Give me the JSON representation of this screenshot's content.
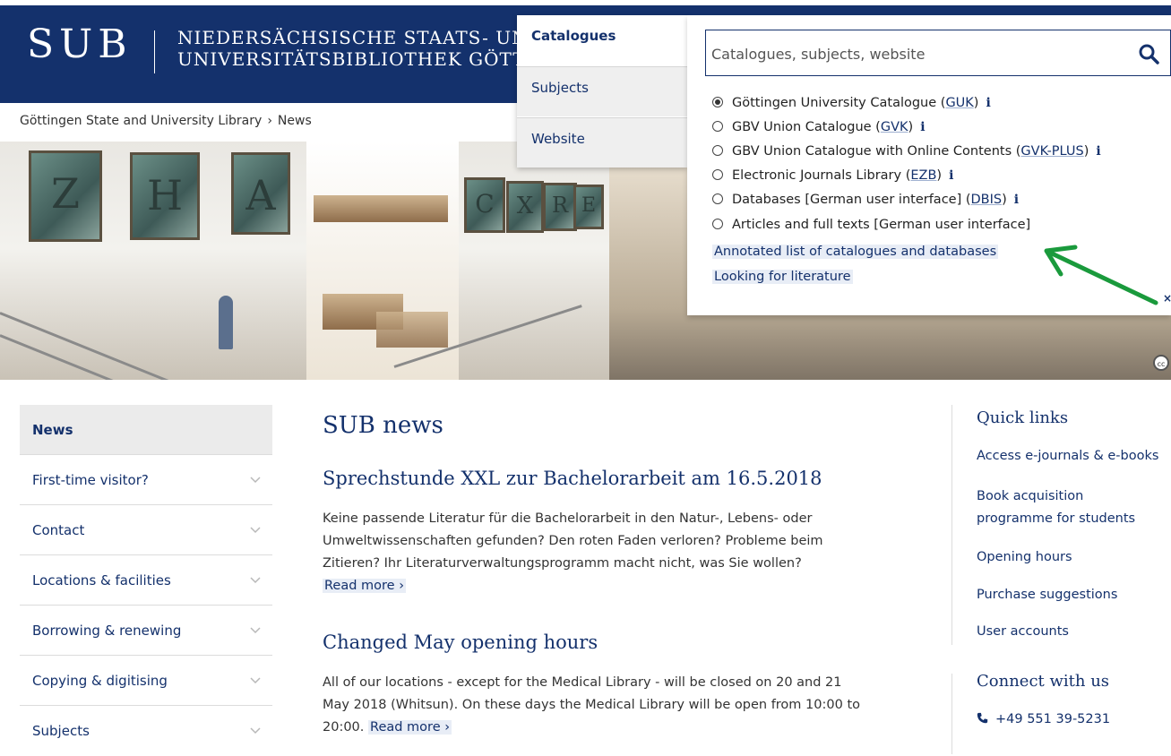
{
  "header": {
    "logo": "SUB",
    "institution_line1": "NIEDERSÄCHSISCHE STAATS- UND",
    "institution_line2": "UNIVERSITÄTSBIBLIOTHEK GÖTTINGEN"
  },
  "breadcrumb": {
    "home": "Göttingen State and University Library",
    "separator": "›",
    "current": "News"
  },
  "hero": {
    "tiles": [
      "Z",
      "H",
      "A",
      "C",
      "X",
      "R",
      "E"
    ]
  },
  "search": {
    "tabs": [
      {
        "label": "Catalogues",
        "active": true
      },
      {
        "label": "Subjects",
        "active": false
      },
      {
        "label": "Website",
        "active": false
      }
    ],
    "placeholder": "Catalogues, subjects, website",
    "options": [
      {
        "label": "Göttingen University Catalogue (",
        "abbr": "GUK",
        "after": ")",
        "selected": true,
        "info": true
      },
      {
        "label": "GBV Union Catalogue (",
        "abbr": "GVK",
        "after": ")",
        "selected": false,
        "info": true
      },
      {
        "label": "GBV Union Catalogue with Online Contents (",
        "abbr": "GVK-PLUS",
        "after": ")",
        "selected": false,
        "info": true
      },
      {
        "label": "Electronic Journals Library (",
        "abbr": "EZB",
        "after": ")",
        "selected": false,
        "info": true
      },
      {
        "label": "Databases [German user interface] (",
        "abbr": "DBIS",
        "after": ")",
        "selected": false,
        "info": true
      },
      {
        "label": "Articles and full texts [German user interface]",
        "abbr": "",
        "after": "",
        "selected": false,
        "info": false
      }
    ],
    "link_annotated": "Annotated list of catalogues and databases",
    "link_looking": "Looking for literature",
    "info_glyph": "i",
    "arrow_color": "#1a9a3c"
  },
  "sidebar": {
    "items": [
      {
        "label": "News",
        "active": true
      },
      {
        "label": "First-time visitor?"
      },
      {
        "label": "Contact"
      },
      {
        "label": "Locations & facilities"
      },
      {
        "label": "Borrowing & renewing"
      },
      {
        "label": "Copying & digitising"
      },
      {
        "label": "Subjects"
      }
    ]
  },
  "main": {
    "title": "SUB news",
    "articles": [
      {
        "title": "Sprechstunde XXL zur Bachelorarbeit am 16.5.2018",
        "lines": [
          "Keine passende Literatur für die Bachelorarbeit in den Natur-, Lebens- oder",
          "Umweltwissenschaften gefunden? Den roten Faden verloren? Probleme beim",
          "Zitieren? Ihr Literaturverwaltungsprogramm macht nicht, was Sie wollen?"
        ],
        "read_more": "Read more ›"
      },
      {
        "title": "Changed May opening hours",
        "lines": [
          "All of our locations - except for the Medical Library - will be closed on 20 and 21",
          "May 2018 (Whitsun). On these days the Medical Library will be open from 10:00 to",
          "20:00."
        ],
        "read_more": "Read more ›"
      }
    ]
  },
  "quick_links": {
    "title": "Quick links",
    "links": [
      "Access e-journals & e-books",
      "Book acquisition",
      "programme for students",
      "Opening hours",
      "Purchase suggestions",
      "User accounts"
    ]
  },
  "connect": {
    "title": "Connect with us",
    "phone": "+49 551 39-5231"
  },
  "colors": {
    "brand_blue": "#14316c",
    "link_bg": "#e8edf6"
  }
}
